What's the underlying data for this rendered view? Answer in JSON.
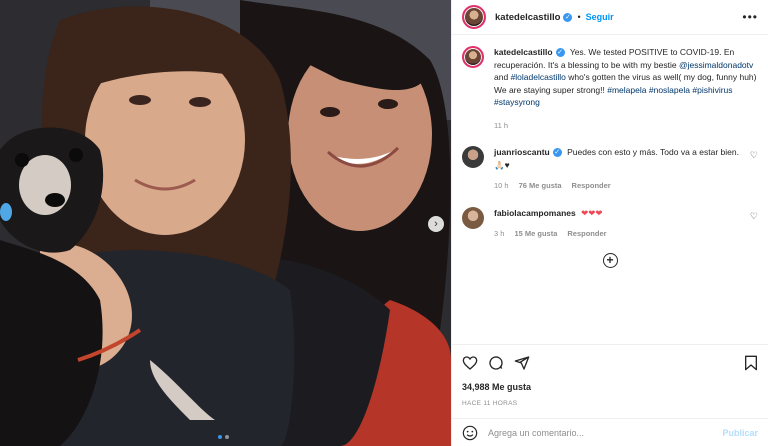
{
  "post": {
    "username": "katedelcastillo",
    "follow_label": "Seguir",
    "separator": "•",
    "more_icon": "more-horizontal-icon",
    "caption": {
      "username": "katedelcastillo",
      "text_part1": "Yes. We tested POSITIVE to COVID-19. En recuperación. It's a blessing to be with my bestie",
      "mention1": "@jessimaldonadotv",
      "text_part2": "and",
      "mention2": "#loladelcastillo",
      "text_part3": "who's gotten the virus as well( my dog, funny huh) We are staying super strong!!",
      "tag1": "#melapela",
      "tag2": "#noslapela",
      "tag3": "#pishivirus",
      "tag4": "#staysyrong",
      "time": "11 h"
    },
    "comments": [
      {
        "username": "juanrioscantu",
        "text": "Puedes con esto y más. Todo va a estar bien.",
        "emoji": "🙏🏻♥",
        "time": "10 h",
        "likes": "76 Me gusta",
        "reply": "Responder"
      },
      {
        "username": "fabiolacampomanes",
        "text": "",
        "emoji": "❤❤❤",
        "time": "3 h",
        "likes": "15 Me gusta",
        "reply": "Responder"
      }
    ],
    "likes_count": "34,988 Me gusta",
    "timestamp": "HACE 11 HORAS",
    "comment_placeholder": "Agrega un comentario...",
    "publish_label": "Publicar",
    "carousel": {
      "current": 1,
      "total": 2
    }
  },
  "colors": {
    "accent": "#0095f6",
    "verified": "#3897f0",
    "hashtag": "#00376b",
    "heart_red": "#ed4956",
    "active_dot": "#3a94e8"
  }
}
